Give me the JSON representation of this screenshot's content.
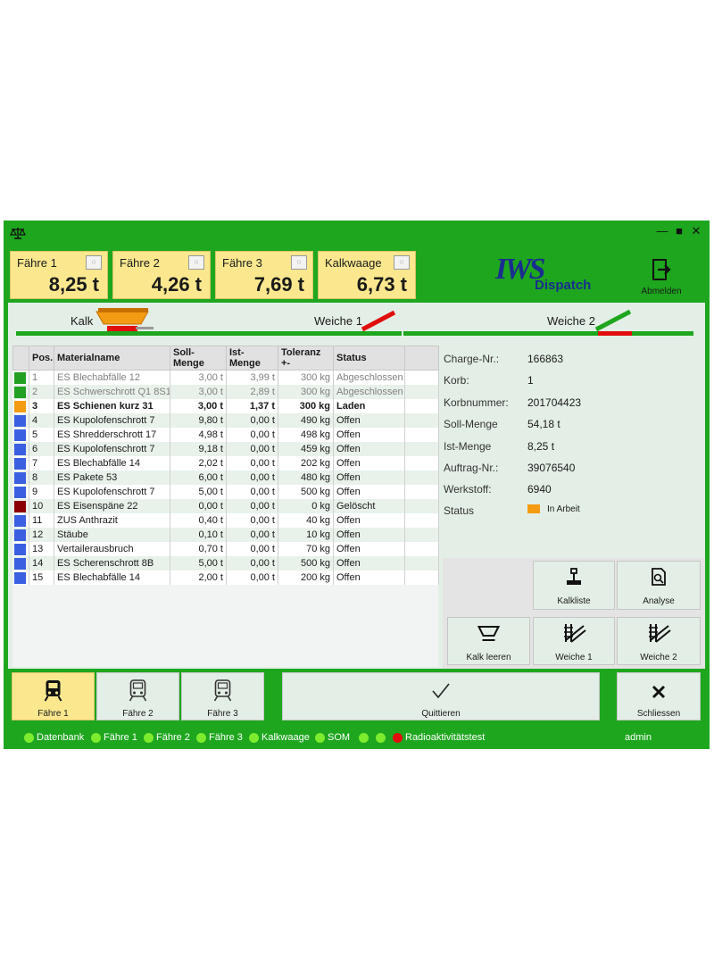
{
  "window": {
    "icons": {
      "app": "scale-icon",
      "minimize": "minimize-icon",
      "maximize": "maximize-icon",
      "close": "close-icon"
    }
  },
  "scales": [
    {
      "label": "Fähre 1",
      "value": "8,25 t"
    },
    {
      "label": "Fähre 2",
      "value": "4,26 t"
    },
    {
      "label": "Fähre 3",
      "value": "7,69 t"
    },
    {
      "label": "Kalkwaage",
      "value": "6,73 t"
    }
  ],
  "tare_icon": "tare-icon",
  "logo": {
    "brand": "IWS",
    "product": "Dispatch"
  },
  "logout": {
    "label": "Abmelden",
    "icon": "logout-icon"
  },
  "track": {
    "kalk": "Kalk",
    "weiche1": "Weiche 1",
    "weiche2": "Weiche 2"
  },
  "table": {
    "headers": [
      "",
      "Pos.",
      "Materialname",
      "Soll-Menge",
      "Ist-Menge",
      "Toleranz +-",
      "Status",
      ""
    ],
    "rows": [
      {
        "color": "#21a021",
        "pos": "1",
        "name": "ES Blechabfälle 12",
        "soll": "3,00 t",
        "ist": "3,99 t",
        "tol": "300 kg",
        "status": "Abgeschlossen",
        "state": "done"
      },
      {
        "color": "#21a021",
        "pos": "2",
        "name": "ES Schwerschrott Q1 8S1",
        "soll": "3,00 t",
        "ist": "2,89 t",
        "tol": "300 kg",
        "status": "Abgeschlossen",
        "state": "done"
      },
      {
        "color": "#f39b12",
        "pos": "3",
        "name": "ES Schienen kurz 31",
        "soll": "3,00 t",
        "ist": "1,37 t",
        "tol": "300 kg",
        "status": "Laden",
        "state": "active"
      },
      {
        "color": "#3a5fe0",
        "pos": "4",
        "name": "ES Kupolofenschrott 7",
        "soll": "9,80 t",
        "ist": "0,00 t",
        "tol": "490 kg",
        "status": "Offen",
        "state": "open"
      },
      {
        "color": "#3a5fe0",
        "pos": "5",
        "name": "ES Shredderschrott 17",
        "soll": "4,98 t",
        "ist": "0,00 t",
        "tol": "498 kg",
        "status": "Offen",
        "state": "open"
      },
      {
        "color": "#3a5fe0",
        "pos": "6",
        "name": "ES Kupolofenschrott 7",
        "soll": "9,18 t",
        "ist": "0,00 t",
        "tol": "459 kg",
        "status": "Offen",
        "state": "open"
      },
      {
        "color": "#3a5fe0",
        "pos": "7",
        "name": "ES Blechabfälle 14",
        "soll": "2,02 t",
        "ist": "0,00 t",
        "tol": "202 kg",
        "status": "Offen",
        "state": "open"
      },
      {
        "color": "#3a5fe0",
        "pos": "8",
        "name": "ES Pakete 53",
        "soll": "6,00 t",
        "ist": "0,00 t",
        "tol": "480 kg",
        "status": "Offen",
        "state": "open"
      },
      {
        "color": "#3a5fe0",
        "pos": "9",
        "name": "ES Kupolofenschrott 7",
        "soll": "5,00 t",
        "ist": "0,00 t",
        "tol": "500 kg",
        "status": "Offen",
        "state": "open"
      },
      {
        "color": "#8b0000",
        "pos": "10",
        "name": "ES Eisenspäne 22",
        "soll": "0,00 t",
        "ist": "0,00 t",
        "tol": "0 kg",
        "status": "Gelöscht",
        "state": "open"
      },
      {
        "color": "#3a5fe0",
        "pos": "11",
        "name": "ZUS Anthrazit",
        "soll": "0,40 t",
        "ist": "0,00 t",
        "tol": "40 kg",
        "status": "Offen",
        "state": "open"
      },
      {
        "color": "#3a5fe0",
        "pos": "12",
        "name": "Stäube",
        "soll": "0,10 t",
        "ist": "0,00 t",
        "tol": "10 kg",
        "status": "Offen",
        "state": "open"
      },
      {
        "color": "#3a5fe0",
        "pos": "13",
        "name": "Vertailerausbruch",
        "soll": "0,70 t",
        "ist": "0,00 t",
        "tol": "70 kg",
        "status": "Offen",
        "state": "open"
      },
      {
        "color": "#3a5fe0",
        "pos": "14",
        "name": "ES Scherenschrott 8B",
        "soll": "5,00 t",
        "ist": "0,00 t",
        "tol": "500 kg",
        "status": "Offen",
        "state": "open"
      },
      {
        "color": "#3a5fe0",
        "pos": "15",
        "name": "ES Blechabfälle 14",
        "soll": "2,00 t",
        "ist": "0,00 t",
        "tol": "200 kg",
        "status": "Offen",
        "state": "open"
      }
    ]
  },
  "info": [
    {
      "key": "Charge-Nr.:",
      "value": "166863"
    },
    {
      "key": "Korb:",
      "value": "1"
    },
    {
      "key": "Korbnummer:",
      "value": "201704423"
    },
    {
      "key": "Soll-Menge",
      "value": "54,18 t"
    },
    {
      "key": "Ist-Menge",
      "value": "8,25 t"
    },
    {
      "key": "Auftrag-Nr.:",
      "value": "39076540"
    },
    {
      "key": "Werkstoff:",
      "value": "6940"
    },
    {
      "key": "Status",
      "value": "In Arbeit"
    }
  ],
  "buttons": {
    "kalkliste": "Kalkliste",
    "analyse": "Analyse",
    "kalk_leeren": "Kalk leeren",
    "weiche1": "Weiche 1",
    "weiche2": "Weiche 2",
    "faehre1": "Fähre 1",
    "faehre2": "Fähre 2",
    "faehre3": "Fähre 3",
    "quittieren": "Quittieren",
    "schliessen": "Schliessen"
  },
  "statusbar": {
    "items": [
      "Datenbank",
      "Fähre 1",
      "Fähre 2",
      "Fähre 3",
      "Kalkwaage",
      "SOM",
      "",
      "",
      "Radioaktivitätstest"
    ],
    "user": "admin",
    "colors": {
      "ok": "#7dec2f",
      "error": "#e10e0e"
    }
  }
}
